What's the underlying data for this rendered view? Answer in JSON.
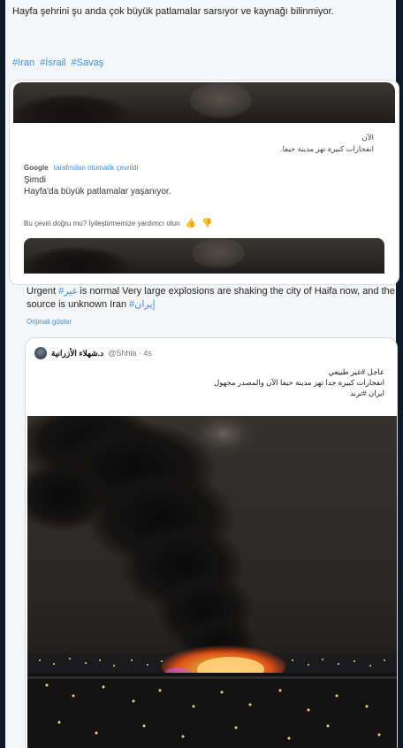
{
  "tweet": {
    "text": "Hayfa şehrini şu anda çok büyük patlamalar sarsıyor ve kaynağı bilinmiyor.",
    "hashtags": [
      "#Iran",
      "#İsrail",
      "#Savaş"
    ]
  },
  "repost_card": {
    "arabic_line1": "الآن",
    "arabic_line2": "انفجارات كبيرة تهز مدينة حيفا.",
    "google_label": "Google",
    "google_link": "tarafından otomatik çevrildi",
    "translated_line1": "Şimdi",
    "translated_line2": "Hayfa'da büyük patlamalar yaşanıyor.",
    "feedback_text": "Bu çeviri doğru mu? İyileştirmemize yardımcı olun"
  },
  "english_tweet": {
    "prefix": "Urgent ",
    "tag1": "#غير",
    "middle": " is normal Very large explosions are shaking the city of Haifa now, and the source is unknown Iran ",
    "tag2": "#إيران",
    "show_original": "Orijinali göster"
  },
  "quoted": {
    "author": "د.شهلاء الأزرانية",
    "handle": "@Shhla · 4s",
    "line1": "عاجل #غير طبيعي",
    "line2": "انفجارات كبيرة جدا تهز مدينة حيفا الآن والمصدر مجهول",
    "line3": "ايران #ترند"
  },
  "colors": {
    "link": "#3a8ed6",
    "fire": "#ff6a1a",
    "background": "#f5f6f7",
    "frame": "#0e1a27"
  },
  "icons": {
    "like": "thumbs-up-icon",
    "dislike": "thumbs-down-icon"
  }
}
